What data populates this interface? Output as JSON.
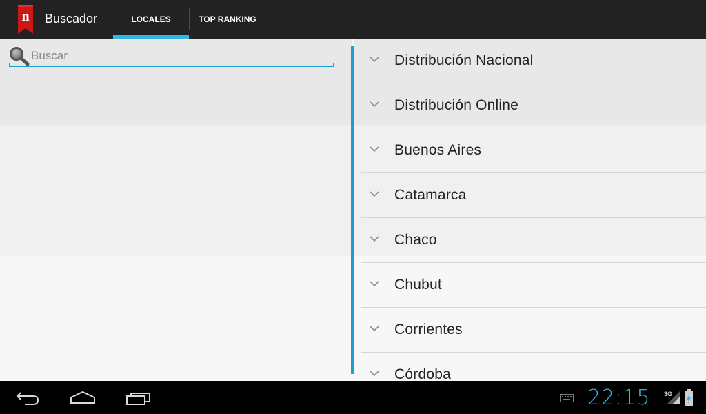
{
  "app": {
    "title": "Buscador",
    "logo_letter": "n",
    "brand_color": "#cc1717"
  },
  "tabs": [
    {
      "label": "LOCALES",
      "selected": true
    },
    {
      "label": "TOP RANKING",
      "selected": false
    }
  ],
  "search": {
    "placeholder": "Buscar",
    "value": ""
  },
  "regions": [
    {
      "label": "Distribución Nacional"
    },
    {
      "label": "Distribución Online"
    },
    {
      "label": "Buenos Aires"
    },
    {
      "label": "Catamarca"
    },
    {
      "label": "Chaco"
    },
    {
      "label": "Chubut"
    },
    {
      "label": "Corrientes"
    },
    {
      "label": "Córdoba"
    }
  ],
  "system_bar": {
    "time": "22:15",
    "network": "3G"
  },
  "colors": {
    "accent": "#33b5e5",
    "divider": "#1f9cd1",
    "actionbar": "#222222"
  }
}
